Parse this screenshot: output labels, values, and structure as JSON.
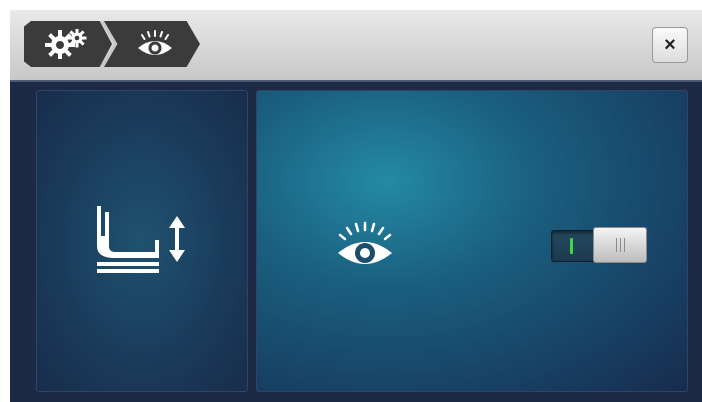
{
  "window": {
    "breadcrumb": [
      {
        "icon": "gears-icon"
      },
      {
        "icon": "eye-icon"
      }
    ],
    "close_label": "×"
  },
  "panels": {
    "left": {
      "icon": "presser-foot-height-icon"
    },
    "right": {
      "icon": "eye-icon",
      "toggle": {
        "state": "on",
        "on_indicator": "green-bar",
        "off_indicator": "grip-lines"
      }
    }
  },
  "colors": {
    "titlebar": "#d3d3d3",
    "background": "#1d2a46",
    "panel_glow": "#248aa3",
    "toggle_on": "#3dd84a"
  }
}
